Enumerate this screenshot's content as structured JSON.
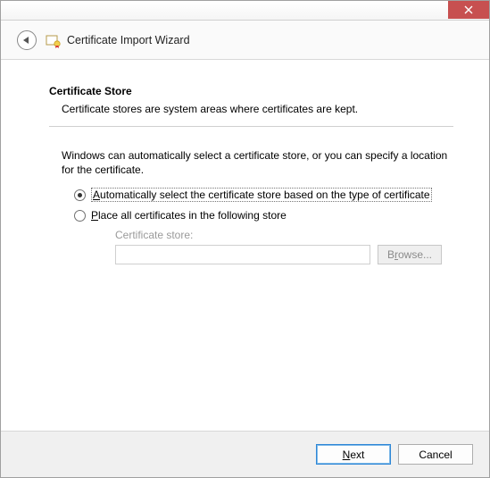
{
  "window": {
    "wizard_title": "Certificate Import Wizard"
  },
  "page": {
    "heading": "Certificate Store",
    "subtitle": "Certificate stores are system areas where certificates are kept.",
    "body": "Windows can automatically select a certificate store, or you can specify a location for the certificate."
  },
  "radios": {
    "auto_prefix": "A",
    "auto_rest": "utomatically select the certificate store based on the type of certificate",
    "auto_selected": true,
    "manual_prefix": "P",
    "manual_rest": "lace all certificates in the following store",
    "manual_selected": false
  },
  "store": {
    "label": "Certificate store:",
    "value": "",
    "browse_prefix": "B",
    "browse_suffix": "r",
    "browse_rest": "owse...",
    "enabled": false
  },
  "footer": {
    "next_prefix": "N",
    "next_rest": "ext",
    "cancel": "Cancel"
  }
}
